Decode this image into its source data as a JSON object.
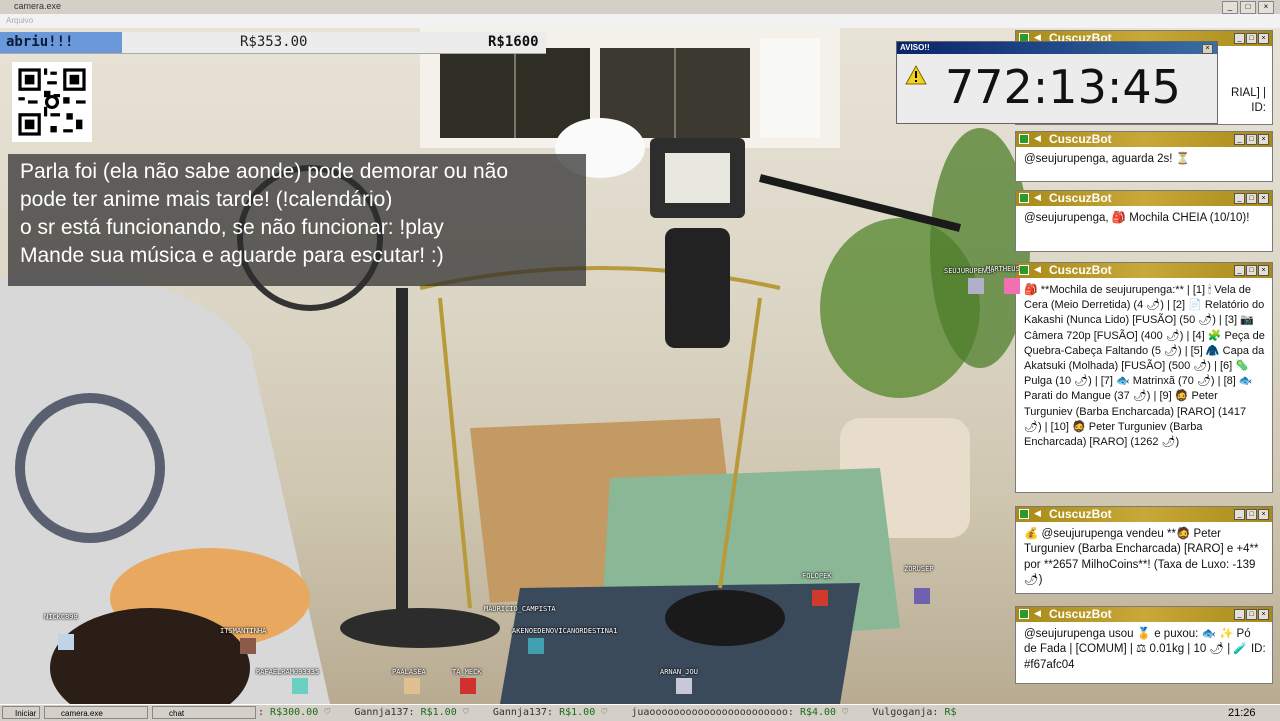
{
  "window": {
    "title": "camera.exe",
    "menu": "Arquivo"
  },
  "stats_bar": {
    "label": "abriu!!!",
    "value1": "R$353.00",
    "value2": "R$1600"
  },
  "announcement": {
    "lines": [
      "Parla foi (ela não sabe aonde) pode demorar ou não",
      "pode ter anime mais tarde! (!calendário)",
      "o sr está funcionando, se não funcionar: !play",
      "Mande sua música e aguarde para escutar! :)"
    ]
  },
  "warning": {
    "title": "AVISO!!",
    "timer": "772:13:45",
    "behind_text": "RIAL] |",
    "behind_text2": "ID:"
  },
  "bot_windows": [
    {
      "name": "CuscuzBot",
      "message": "@seujurupenga, aguarda 2s! ⏳"
    },
    {
      "name": "CuscuzBot",
      "message": "@seujurupenga, 🎒 Mochila CHEIA (10/10)!"
    },
    {
      "name": "CuscuzBot",
      "message": "🎒 **Mochila de seujurupenga:** | [1] 🕯 Vela de Cera (Meio Derretida) (4 🌶) | [2] 📄 Relatório do Kakashi (Nunca Lido) [FUSÃO] (50 🌶) | [3] 📷 Câmera 720p [FUSÃO] (400 🌶) | [4] 🧩 Peça de Quebra-Cabeça Faltando (5 🌶) | [5] 🧥 Capa da Akatsuki (Molhada) [FUSÃO] (500 🌶) | [6] 🦠 Pulga (10 🌶) | [7] 🐟 Matrinxã (70 🌶) | [8] 🐟 Parati do Mangue (37 🌶) | [9] 🧔 Peter Turguniev (Barba Encharcada) [RARO] (1417 🌶) | [10] 🧔 Peter Turguniev (Barba Encharcada) [RARO] (1262 🌶)"
    },
    {
      "name": "CuscuzBot",
      "message": "💰 @seujurupenga vendeu **🧔 Peter Turguniev (Barba Encharcada) [RARO] e +4** por **2657 MilhoCoins**! (Taxa de Luxo: -139 🌶)"
    },
    {
      "name": "CuscuzBot",
      "message": "@seujurupenga usou 🏅 e puxou: 🐟 ✨ Pó de Fada | [COMUM] | ⚖ 0.01kg | 10 🌶 | 🧪 ID: #f67afc04"
    }
  ],
  "viewers": [
    "NICKC898",
    "ITSMANTINHA",
    "RAFAELRAM093335",
    "PAALASEA",
    "TA_MECK",
    "MAURICIO_CAMPISTA",
    "AKENOEDENOVICANORDESTINA1",
    "ARNAN_JOU",
    "FOLOPEK",
    "ZORUSEP",
    "SEUJURUPENGA",
    "MARTHEUS"
  ],
  "taskbar": {
    "start_label": "Iniciar",
    "items": [
      "camera.exe",
      "chat"
    ],
    "ticker": [
      {
        "prefix": ": ",
        "amount": "R$300.00",
        "sep": " ♡"
      },
      {
        "prefix": "Gannja137: ",
        "amount": "R$1.00",
        "sep": " ♡"
      },
      {
        "prefix": "Gannja137: ",
        "amount": "R$1.00",
        "sep": " ♡"
      },
      {
        "prefix": "juaooooooooooooooooooooooo: ",
        "amount": "R$4.00",
        "sep": " ♡"
      },
      {
        "prefix": "Vulgoganja: ",
        "amount": "R$",
        "sep": ""
      }
    ],
    "clock": "21:26"
  },
  "colors": {
    "stats_accent": "#6a98d8",
    "bot_titlebar": "#b8982a",
    "warning_titlebar": "#0a246a",
    "ticker_amount": "#1a6a1a"
  }
}
